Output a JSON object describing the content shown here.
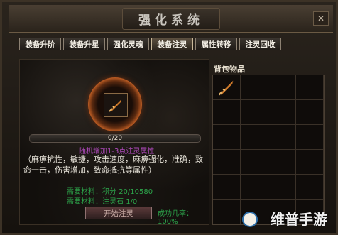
{
  "window": {
    "title": "强化系统",
    "close": "✕"
  },
  "tabs": [
    "装备升阶",
    "装备升星",
    "强化灵魂",
    "装备注灵",
    "属性转移",
    "注灵回收"
  ],
  "active_tab_index": 3,
  "progress": {
    "text": "0/20",
    "fraction": 0.0
  },
  "effect_title": "随机增加1-3点注灵属性",
  "description": "（麻痹抗性，敏捷，攻击速度，麻痹强化，准确，致命一击，伤害增加，致命抵抗等属性）",
  "requirements": [
    {
      "label": "需要材料：积分",
      "value": "20/10580"
    },
    {
      "label": "需要材料：注灵石",
      "value": "1/0"
    }
  ],
  "start_button": "开始注灵",
  "success_rate": "成功几率：100%",
  "bag": {
    "title": "背包物品"
  },
  "watermark": "维普手游",
  "colors": {
    "accent": "#b85a22",
    "success": "#2ca44a",
    "purple": "#b04abd"
  }
}
